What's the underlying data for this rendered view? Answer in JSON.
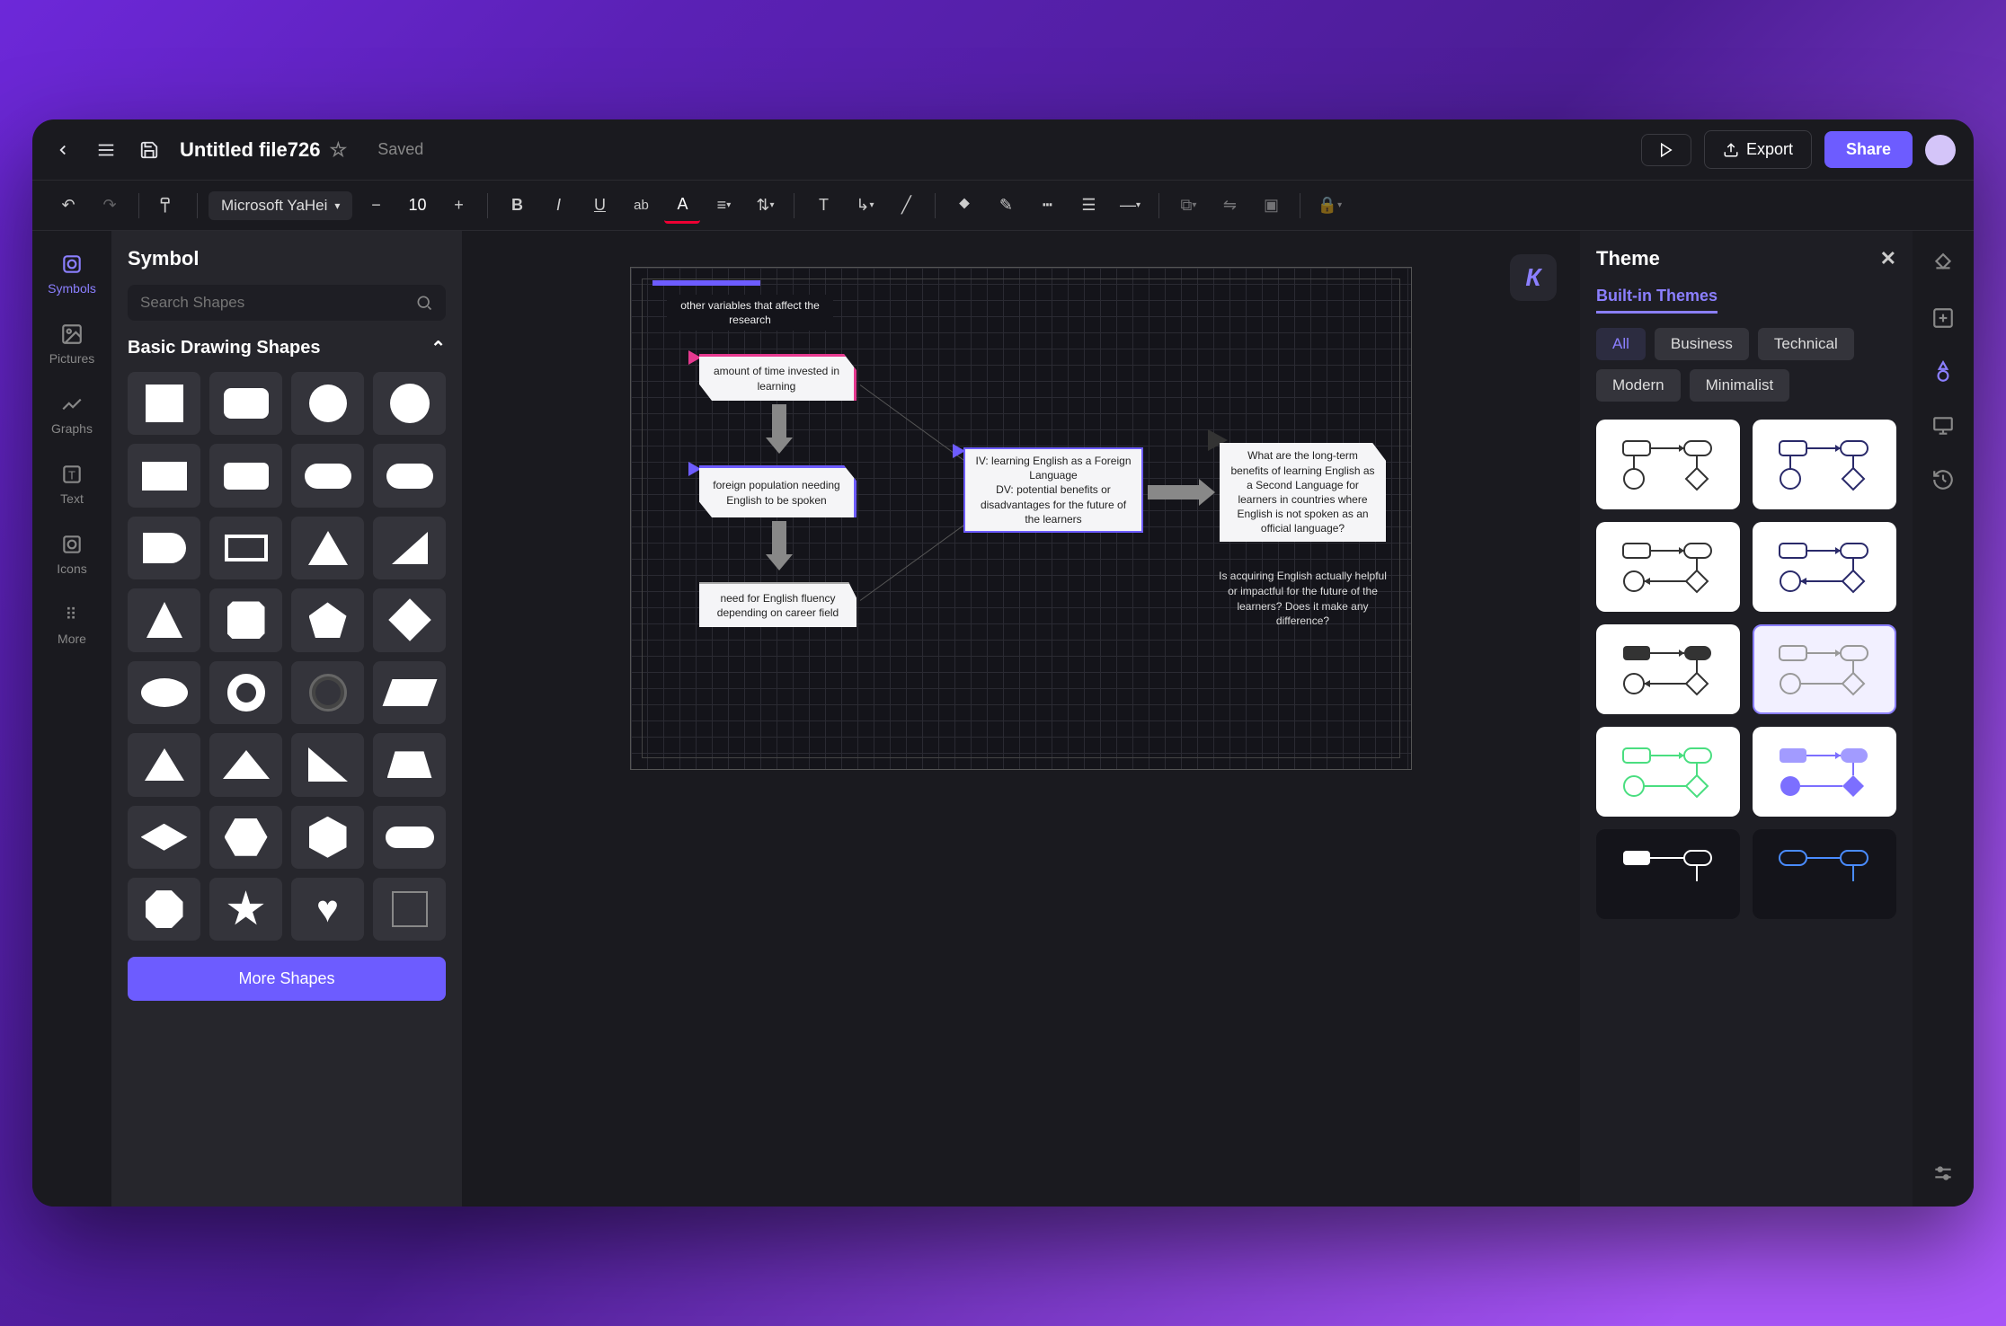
{
  "header": {
    "file_name": "Untitled file726",
    "saved_status": "Saved",
    "export_label": "Export",
    "share_label": "Share"
  },
  "toolbar": {
    "font_family": "Microsoft YaHei",
    "font_size": "10"
  },
  "left_rail": [
    {
      "label": "Symbols",
      "icon": "symbols"
    },
    {
      "label": "Pictures",
      "icon": "pictures"
    },
    {
      "label": "Graphs",
      "icon": "graphs"
    },
    {
      "label": "Text",
      "icon": "text"
    },
    {
      "label": "Icons",
      "icon": "icons"
    },
    {
      "label": "More",
      "icon": "more"
    }
  ],
  "symbol_panel": {
    "title": "Symbol",
    "search_placeholder": "Search Shapes",
    "category": "Basic Drawing Shapes",
    "more_label": "More Shapes"
  },
  "canvas": {
    "header_text": "other variables that affect the research",
    "node1": "amount of time invested in learning",
    "node2": "foreign population needing English to be spoken",
    "node3": "need for English fluency depending on career field",
    "node4": "IV: learning English as a Foreign Language\nDV: potential benefits or disadvantages for the future of the learners",
    "node5": "What are the long-term benefits of learning English as a Second Language for learners in countries where English is not spoken as an official language?",
    "note": "Is acquiring English actually helpful or impactful for the future of the learners? Does it make any difference?"
  },
  "theme_panel": {
    "title": "Theme",
    "subtitle": "Built-in Themes",
    "chips": [
      "All",
      "Business",
      "Technical",
      "Modern",
      "Minimalist"
    ]
  }
}
